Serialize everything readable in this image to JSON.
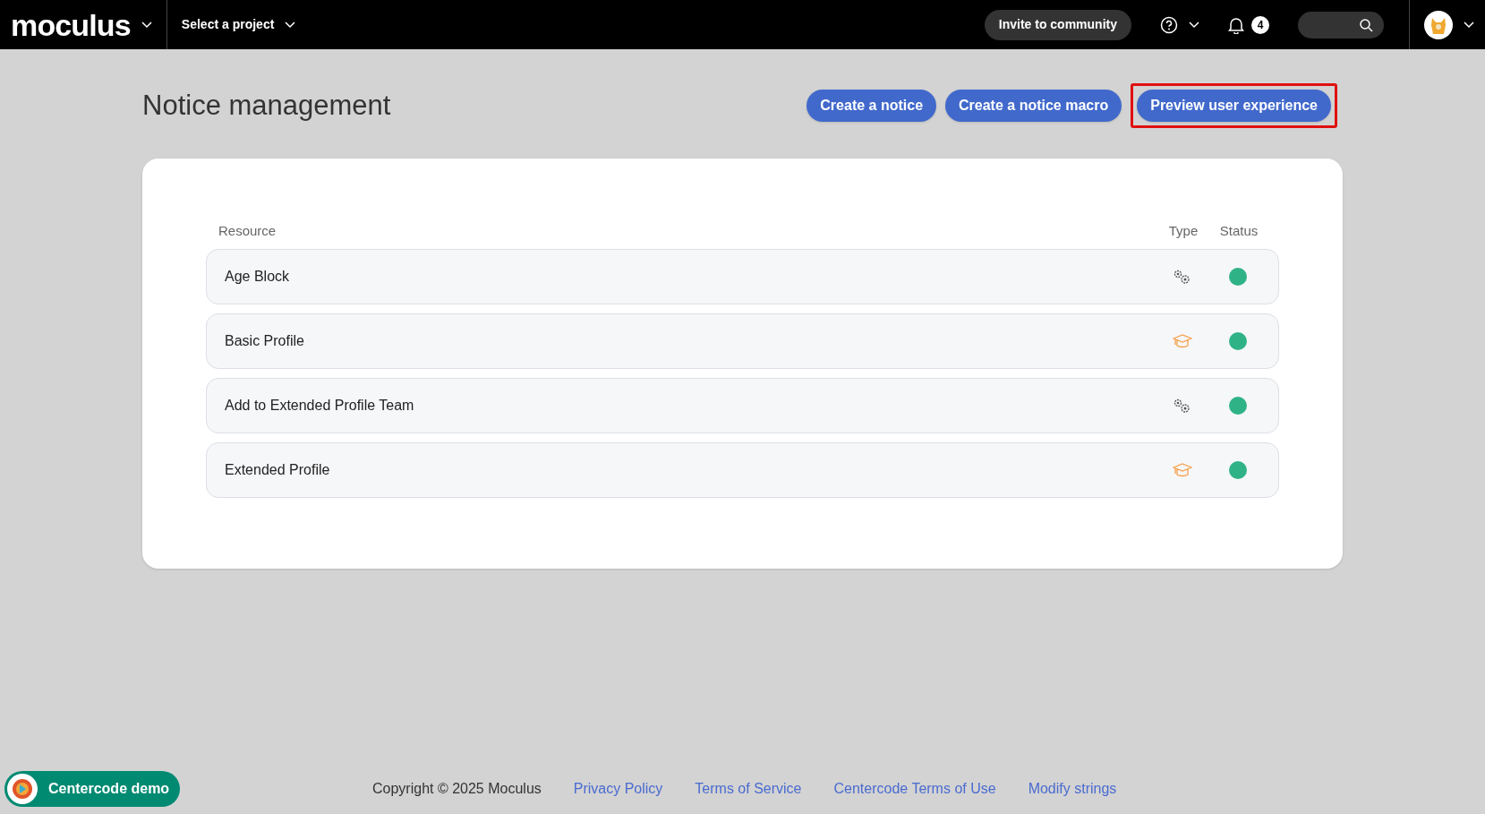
{
  "header": {
    "logo": "moculus",
    "project_selector": "Select a project",
    "invite_button": "Invite to community",
    "notification_count": "4"
  },
  "page": {
    "title": "Notice management",
    "actions": [
      {
        "label": "Create a notice",
        "highlighted": false
      },
      {
        "label": "Create a notice macro",
        "highlighted": false
      },
      {
        "label": "Preview user experience",
        "highlighted": true
      }
    ]
  },
  "table": {
    "columns": [
      "Resource",
      "Type",
      "Status"
    ],
    "rows": [
      {
        "resource": "Age Block",
        "kind": "gears",
        "active": true
      },
      {
        "resource": "Basic Profile",
        "kind": "cap",
        "active": true
      },
      {
        "resource": "Add to Extended Profile Team",
        "kind": "gears",
        "active": true
      },
      {
        "resource": "Extended Profile",
        "kind": "cap",
        "active": true
      }
    ]
  },
  "demo_badge": "Centercode demo",
  "footer": {
    "copyright": "Copyright © 2025 Moculus",
    "links": [
      "Privacy Policy",
      "Terms of Service",
      "Centercode Terms of Use",
      "Modify strings"
    ]
  }
}
